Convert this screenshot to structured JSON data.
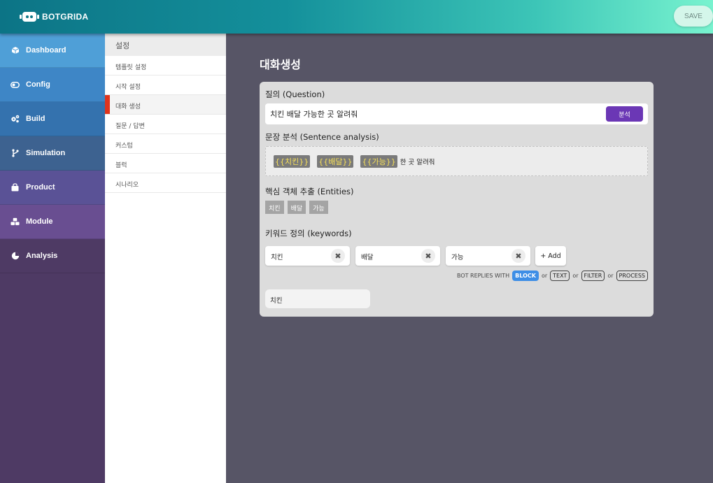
{
  "header": {
    "logo_text": "BOTGRIDA",
    "save_label": "SAVE"
  },
  "nav": {
    "items": [
      {
        "label": "Dashboard",
        "icon": "cube-icon",
        "color": "#4f9fd7"
      },
      {
        "label": "Config",
        "icon": "toggle-icon",
        "color": "#3e86c6"
      },
      {
        "label": "Build",
        "icon": "gears-icon",
        "color": "#3472ae"
      },
      {
        "label": "Simulation",
        "icon": "branch-icon",
        "color": "#3d6290"
      },
      {
        "label": "Product",
        "icon": "bag-icon",
        "color": "#5a5296"
      },
      {
        "label": "Module",
        "icon": "cubes-icon",
        "color": "#694e91"
      },
      {
        "label": "Analysis",
        "icon": "pie-icon",
        "color": "#4e3a64"
      }
    ]
  },
  "submenu": {
    "title": "설정",
    "items": [
      "템플릿 설정",
      "시작 설정",
      "대화 생성",
      "질문 / 답변",
      "커스텀",
      "블럭",
      "시나리오"
    ],
    "active_index": 2
  },
  "main": {
    "page_title": "대화생성",
    "question": {
      "label": "질의 (Question)",
      "value": "치킨 배달 가능한 곳 알려줘",
      "analyze_label": "분석"
    },
    "analysis": {
      "label": "문장 분석 (Sentence analysis)",
      "tokens": [
        "{{치킨}}",
        "{{배달}}",
        "{{가능}}"
      ],
      "rest": "한 곳 알려줘"
    },
    "entities": {
      "label": "핵심 객체 추출 (Entities)",
      "items": [
        "치킨",
        "배달",
        "가능"
      ]
    },
    "keywords": {
      "label": "키워드 정의 (keywords)",
      "items": [
        "치킨",
        "배달",
        "가능"
      ],
      "add_label": "+ Add"
    },
    "replies": {
      "prefix": "BOT REPLIES WITH",
      "or": "or",
      "options": [
        "BLOCK",
        "TEXT",
        "FILTER",
        "PROCESS"
      ],
      "active": "BLOCK"
    },
    "reply_value": "치킨"
  }
}
